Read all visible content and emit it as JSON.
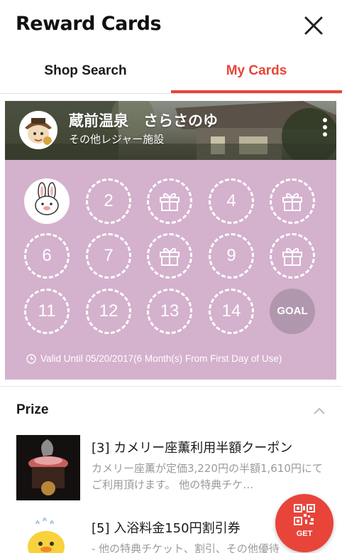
{
  "header": {
    "title": "Reward Cards",
    "close_icon": "close-icon"
  },
  "tabs": [
    {
      "label": "Shop Search",
      "active": false
    },
    {
      "label": "My Cards",
      "active": true
    }
  ],
  "card": {
    "shop_name": "蔵前温泉　さらさのゆ",
    "category": "その他レジャー施設",
    "background_color": "#d4b1cd",
    "stamps": [
      {
        "label": "",
        "type": "stamped"
      },
      {
        "label": "2",
        "type": "number"
      },
      {
        "label": "",
        "type": "gift"
      },
      {
        "label": "4",
        "type": "number"
      },
      {
        "label": "",
        "type": "gift"
      },
      {
        "label": "6",
        "type": "number"
      },
      {
        "label": "7",
        "type": "number"
      },
      {
        "label": "",
        "type": "gift"
      },
      {
        "label": "9",
        "type": "number"
      },
      {
        "label": "",
        "type": "gift"
      },
      {
        "label": "11",
        "type": "number"
      },
      {
        "label": "12",
        "type": "number"
      },
      {
        "label": "13",
        "type": "number"
      },
      {
        "label": "14",
        "type": "number"
      },
      {
        "label": "GOAL",
        "type": "goal"
      }
    ],
    "validity": "Valid Until 05/20/2017(6 Month(s) From First Day of Use)"
  },
  "prize": {
    "title": "Prize",
    "items": [
      {
        "name": "[3] カメリー座薫利用半額クーポン",
        "description": "カメリー座薫が定価3,220円の半額1,610円にてご利用頂けます。 他の特典チケ…"
      },
      {
        "name": "[5] 入浴料金150円割引券",
        "description": "- 他の特典チケット、割引、その他優待"
      }
    ]
  },
  "get_button": {
    "label": "GET",
    "icon": "qr-code-icon"
  },
  "colors": {
    "accent": "#e8443a",
    "card": "#d4b1cd",
    "goal": "#b197ad"
  }
}
